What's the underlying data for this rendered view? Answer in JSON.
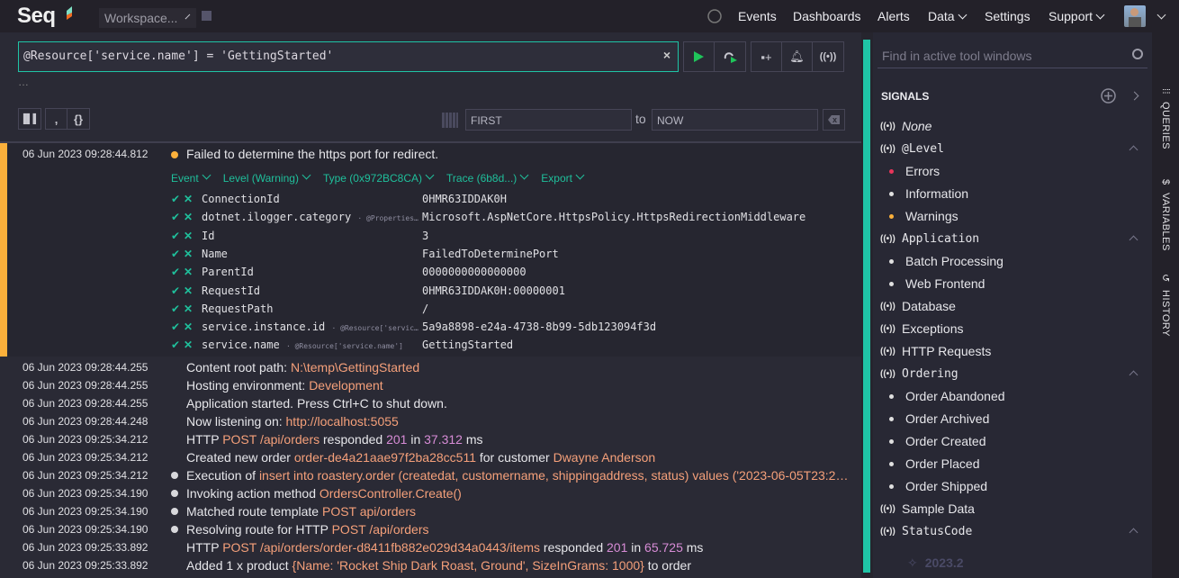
{
  "topbar": {
    "logo": "Seq",
    "workspace": "Workspace...",
    "nav": [
      {
        "label": "Events",
        "dropdown": false
      },
      {
        "label": "Dashboards",
        "dropdown": false
      },
      {
        "label": "Alerts",
        "dropdown": false
      },
      {
        "label": "Data",
        "dropdown": true
      },
      {
        "label": "Settings",
        "dropdown": false
      },
      {
        "label": "Support",
        "dropdown": true
      }
    ],
    "theme_icon": "moon-icon",
    "avatar": "user-avatar"
  },
  "search": {
    "query": "@Resource['service.name'] = 'GettingStarted'",
    "clear_icon": "close-icon",
    "ellipsis": "…",
    "from": "FIRST",
    "to_label": "to",
    "to": "NOW"
  },
  "expanded_event": {
    "timestamp": "06 Jun 2023  09:28:44.812",
    "level_color": "#fbb03b",
    "message": "Failed to determine the https port for redirect.",
    "actions": [
      "Event",
      "Level (Warning)",
      "Type (0x972BC8CA)",
      "Trace (6b8d...)",
      "Export"
    ],
    "properties": [
      {
        "name": "ConnectionId",
        "hint": "",
        "value": "0HMR63IDDAK0H"
      },
      {
        "name": "dotnet.ilogger.category",
        "hint": "· @Properties…",
        "value": "Microsoft.AspNetCore.HttpsPolicy.HttpsRedirectionMiddleware"
      },
      {
        "name": "Id",
        "hint": "",
        "value": "3"
      },
      {
        "name": "Name",
        "hint": "",
        "value": "FailedToDeterminePort"
      },
      {
        "name": "ParentId",
        "hint": "",
        "value": "0000000000000000"
      },
      {
        "name": "RequestId",
        "hint": "",
        "value": "0HMR63IDDAK0H:00000001"
      },
      {
        "name": "RequestPath",
        "hint": "",
        "value": "/"
      },
      {
        "name": "service.instance.id",
        "hint": "· @Resource['servic…",
        "value": "5a9a8898-e24a-4738-8b99-5db123094f3d"
      },
      {
        "name": "service.name",
        "hint": "· @Resource['service.name']",
        "value": "GettingStarted"
      }
    ]
  },
  "events": [
    {
      "ts": "06 Jun 2023  09:28:44.255",
      "dot": false,
      "parts": [
        [
          "Content root path: ",
          ""
        ],
        [
          "N:\\temp\\GettingStarted",
          "hl"
        ]
      ]
    },
    {
      "ts": "06 Jun 2023  09:28:44.255",
      "dot": false,
      "parts": [
        [
          "Hosting environment: ",
          ""
        ],
        [
          "Development",
          "hl"
        ]
      ]
    },
    {
      "ts": "06 Jun 2023  09:28:44.255",
      "dot": false,
      "parts": [
        [
          "Application started. Press Ctrl+C to shut down.",
          ""
        ]
      ]
    },
    {
      "ts": "06 Jun 2023  09:28:44.248",
      "dot": false,
      "parts": [
        [
          "Now listening on: ",
          ""
        ],
        [
          "http://localhost:5055",
          "hl"
        ]
      ]
    },
    {
      "ts": "06 Jun 2023  09:25:34.212",
      "dot": false,
      "parts": [
        [
          "HTTP ",
          ""
        ],
        [
          "POST",
          "hl"
        ],
        [
          " ",
          ""
        ],
        [
          "/api/orders",
          "hl"
        ],
        [
          " responded ",
          ""
        ],
        [
          "201",
          "num"
        ],
        [
          " in ",
          ""
        ],
        [
          "37.312",
          "num"
        ],
        [
          " ms",
          ""
        ]
      ]
    },
    {
      "ts": "06 Jun 2023  09:25:34.212",
      "dot": false,
      "parts": [
        [
          "Created new order ",
          ""
        ],
        [
          "order-de4a21aae97f2ba28cc511",
          "hl"
        ],
        [
          " for customer ",
          ""
        ],
        [
          "Dwayne Anderson",
          "hl"
        ]
      ]
    },
    {
      "ts": "06 Jun 2023  09:25:34.212",
      "dot": true,
      "parts": [
        [
          "Execution of ",
          ""
        ],
        [
          "insert into roastery.order (createdat, customername, shippingaddress, status) values ('2023-06-05T23:2…",
          "hl"
        ]
      ]
    },
    {
      "ts": "06 Jun 2023  09:25:34.190",
      "dot": true,
      "parts": [
        [
          "Invoking action method ",
          ""
        ],
        [
          "OrdersController.Create()",
          "hl"
        ]
      ]
    },
    {
      "ts": "06 Jun 2023  09:25:34.190",
      "dot": true,
      "parts": [
        [
          "Matched route template ",
          ""
        ],
        [
          "POST api/orders",
          "hl"
        ]
      ]
    },
    {
      "ts": "06 Jun 2023  09:25:34.190",
      "dot": true,
      "parts": [
        [
          "Resolving route for HTTP ",
          ""
        ],
        [
          "POST",
          "hl"
        ],
        [
          " ",
          ""
        ],
        [
          "/api/orders",
          "hl"
        ]
      ]
    },
    {
      "ts": "06 Jun 2023  09:25:33.892",
      "dot": false,
      "parts": [
        [
          "HTTP ",
          ""
        ],
        [
          "POST",
          "hl"
        ],
        [
          " ",
          ""
        ],
        [
          "/api/orders/order-d8411fb882e029d34a0443/items",
          "hl"
        ],
        [
          " responded ",
          ""
        ],
        [
          "201",
          "num"
        ],
        [
          " in ",
          ""
        ],
        [
          "65.725",
          "num"
        ],
        [
          " ms",
          ""
        ]
      ]
    },
    {
      "ts": "06 Jun 2023  09:25:33.892",
      "dot": false,
      "parts": [
        [
          "Added 1 x product ",
          ""
        ],
        [
          "{Name: 'Rocket Ship Dark Roast, Ground', SizeInGrams: 1000}",
          "hl"
        ],
        [
          " to order",
          ""
        ]
      ]
    }
  ],
  "sidebar": {
    "find_placeholder": "Find in active tool windows",
    "signals_title": "SIGNALS",
    "items": [
      {
        "type": "signal",
        "label": "None",
        "italic": true,
        "mono": false,
        "collapsible": false
      },
      {
        "type": "signal",
        "label": "@Level",
        "mono": true,
        "collapsible": true
      },
      {
        "type": "sub",
        "label": "Errors",
        "color": "#e8355a"
      },
      {
        "type": "sub",
        "label": "Information",
        "color": "#e0e0e0"
      },
      {
        "type": "sub",
        "label": "Warnings",
        "color": "#fbb03b"
      },
      {
        "type": "signal",
        "label": "Application",
        "mono": true,
        "collapsible": true
      },
      {
        "type": "sub",
        "label": "Batch Processing",
        "color": "#e0e0e0"
      },
      {
        "type": "sub",
        "label": "Web Frontend",
        "color": "#e0e0e0"
      },
      {
        "type": "signal",
        "label": "Database",
        "mono": false,
        "collapsible": false
      },
      {
        "type": "signal",
        "label": "Exceptions",
        "mono": false,
        "collapsible": false
      },
      {
        "type": "signal",
        "label": "HTTP Requests",
        "mono": false,
        "collapsible": false
      },
      {
        "type": "signal",
        "label": "Ordering",
        "mono": true,
        "collapsible": true
      },
      {
        "type": "sub",
        "label": "Order Abandoned",
        "color": "#e0e0e0"
      },
      {
        "type": "sub",
        "label": "Order Archived",
        "color": "#e0e0e0"
      },
      {
        "type": "sub",
        "label": "Order Created",
        "color": "#e0e0e0"
      },
      {
        "type": "sub",
        "label": "Order Placed",
        "color": "#e0e0e0"
      },
      {
        "type": "sub",
        "label": "Order Shipped",
        "color": "#e0e0e0"
      },
      {
        "type": "signal",
        "label": "Sample Data",
        "mono": false,
        "collapsible": false
      },
      {
        "type": "signal",
        "label": "StatusCode",
        "mono": true,
        "collapsible": true
      }
    ],
    "version": "2023.2"
  },
  "rail": {
    "tabs": [
      "QUERIES",
      "VARIABLES",
      "HISTORY"
    ]
  },
  "colors": {
    "accent": "#1fc4a6",
    "warning": "#fbb03b",
    "error": "#e8355a",
    "highlight": "#f5a07a",
    "number": "#d78cd6"
  }
}
